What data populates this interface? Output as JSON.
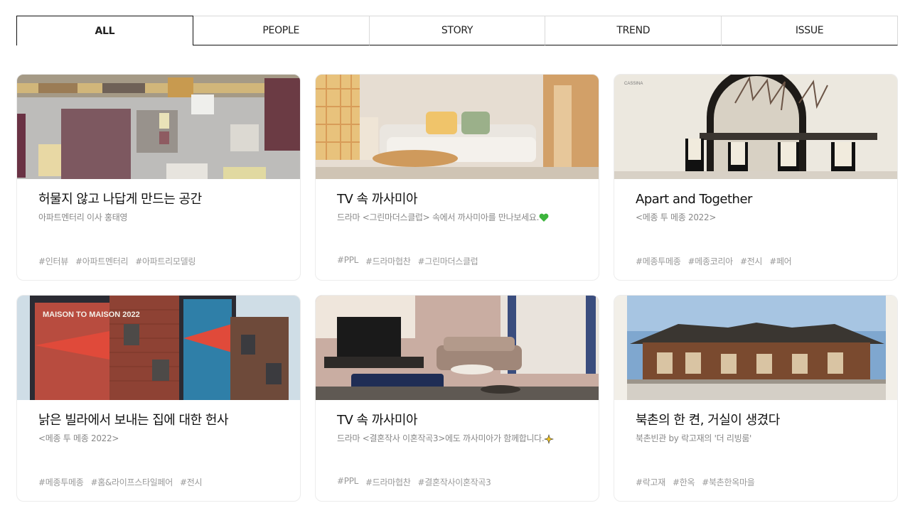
{
  "tabs": [
    {
      "label": "ALL",
      "active": true
    },
    {
      "label": "PEOPLE"
    },
    {
      "label": "STORY"
    },
    {
      "label": "TREND"
    },
    {
      "label": "ISSUE"
    }
  ],
  "cards": [
    {
      "title": "허물지 않고 나답게 만드는 공간",
      "subtitle": "아파트멘터리 이사 홍태영",
      "tags": [
        "#인터뷰",
        "#아파트멘터리",
        "#아파트리모델링"
      ]
    },
    {
      "title": "TV 속 까사미아",
      "subtitle": "드라마 <그린마더스클럽> 속에서 까사미아를 만나보세요.",
      "tags": [
        "#PPL",
        "#드라마협찬",
        "#그린마더스클럽"
      ]
    },
    {
      "title": "Apart and Together",
      "subtitle": "<메종 투 메종 2022>",
      "tags": [
        "#메종투메종",
        "#메종코리아",
        "#전시",
        "#페어"
      ]
    },
    {
      "title": "낡은 빌라에서 보내는 집에 대한 헌사",
      "subtitle": "<메종 투 메종 2022>",
      "tags": [
        "#메종투메종",
        "#홈&라이프스타일페어",
        "#전시"
      ]
    },
    {
      "title": "TV 속 까사미아",
      "subtitle": "드라마 <결혼작사 이혼작곡3>에도 까사미아가 함께합니다.",
      "tags": [
        "#PPL",
        "#드라마협찬",
        "#결혼작사이혼작곡3"
      ]
    },
    {
      "title": "북촌의 한 켠, 거실이 생겼다",
      "subtitle": "북촌빈관 by 락고재의 '더 리빙룸'",
      "tags": [
        "#락고재",
        "#한옥",
        "#북촌한옥마을"
      ]
    }
  ],
  "images": {
    "card1": "material-samples-photo",
    "card2": "living-room-sofa-photo",
    "card3": "dining-exhibition-photo",
    "card4": "brick-building-banners-photo",
    "card5": "tv-living-room-photo",
    "card6": "hanok-building-photo",
    "banner_text": "MAISON TO MAISON 2022"
  }
}
